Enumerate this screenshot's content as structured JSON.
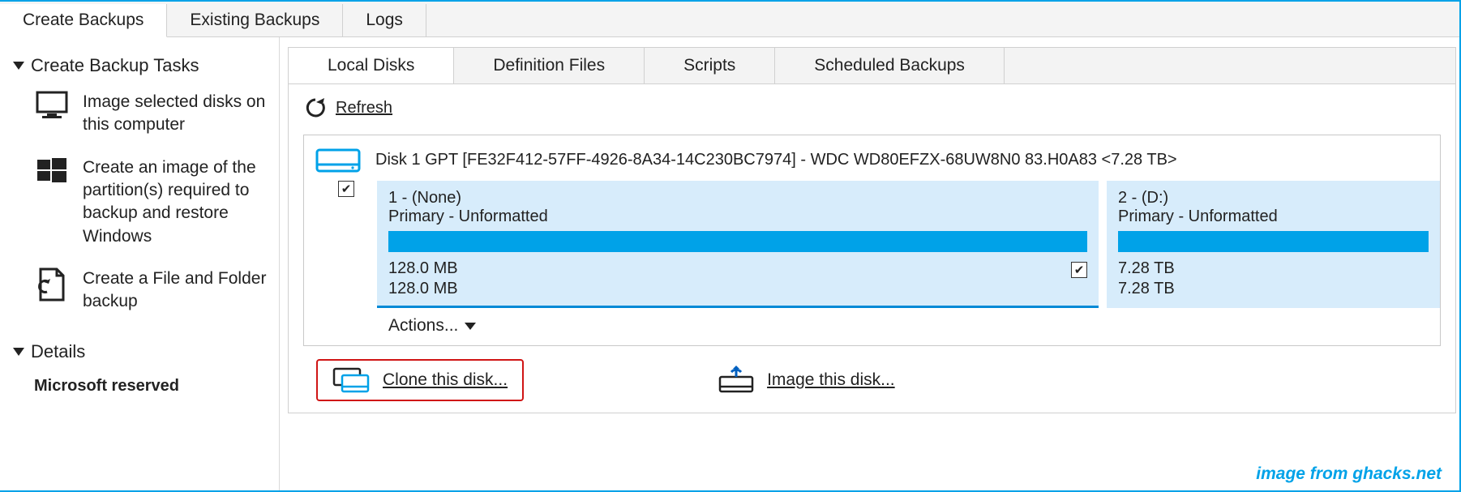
{
  "top_tabs": {
    "create": "Create Backups",
    "existing": "Existing Backups",
    "logs": "Logs"
  },
  "sidebar": {
    "group1": "Create Backup Tasks",
    "items": [
      "Image selected disks on this computer",
      "Create an image of the partition(s) required to backup and restore Windows",
      "Create a File and Folder backup"
    ],
    "group2": "Details",
    "details_title": "Microsoft reserved"
  },
  "sub_tabs": {
    "local": "Local Disks",
    "defs": "Definition Files",
    "scripts": "Scripts",
    "sched": "Scheduled Backups"
  },
  "refresh": "Refresh",
  "disk": {
    "title": "Disk 1 GPT [FE32F412-57FF-4926-8A34-14C230BC7974] - WDC WD80EFZX-68UW8N0 83.H0A83  <7.28 TB>",
    "partitions": [
      {
        "idx": "1 -  (None)",
        "type": "Primary - Unformatted",
        "size1": "128.0 MB",
        "size2": "128.0 MB",
        "checked": true
      },
      {
        "idx": "2 -  (D:)",
        "type": "Primary - Unformatted",
        "size1": "7.28 TB",
        "size2": "7.28 TB",
        "checked": false
      }
    ],
    "actions": "Actions..."
  },
  "bottom": {
    "clone": "Clone this disk...",
    "image": "Image this disk..."
  },
  "credit": "image from ghacks.net"
}
